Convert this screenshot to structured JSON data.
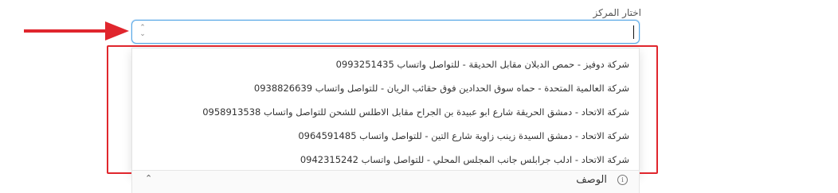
{
  "field": {
    "label": "اختار المركز",
    "value": ""
  },
  "dropdown": {
    "options": [
      "شركة دوفيز - حمص الدبلان مقابل الحديقة - للتواصل واتساب 0993251435",
      "شركة العالمية المتحدة - حماه سوق الحدادين فوق حقائب الريان - للتواصل واتساب 0938826639",
      "شركة الاتحاد - دمشق الحريقة شارع ابو عبيدة بن الجراح مقابل الاطلس للشحن  للتواصل واتساب 0958913538",
      "شركة الاتحاد - دمشق السيدة زينب زاوية شارع التين   - للتواصل واتساب 0964591485",
      "شركة الاتحاد - ادلب جرابلس جانب المجلس المحلي   - للتواصل واتساب 0942315242"
    ]
  },
  "description": {
    "title": "الوصف"
  },
  "annotations": {
    "arrow_color": "#e0262d",
    "frame_color": "#e0262d"
  },
  "icons": {
    "select_toggle": "up-down-chevron-icon",
    "info": "info-icon",
    "collapse": "chevron-up-icon"
  }
}
